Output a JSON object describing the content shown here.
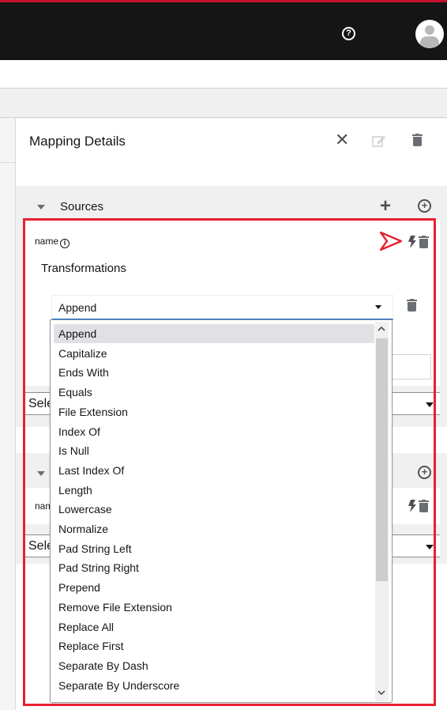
{
  "header": {
    "help_icon": "question-circle-icon",
    "avatar_icon": "user-avatar-icon",
    "brand_color": "#c8102e"
  },
  "panel": {
    "title": "Mapping Details",
    "close_icon": "close-icon",
    "edit_icon": "edit-icon",
    "delete_icon": "trash-icon"
  },
  "sources": {
    "label": "Sources",
    "add_icon": "plus-icon",
    "add_circle_icon": "plus-circle-icon",
    "field": {
      "name": "name",
      "info_icon": "info-icon"
    },
    "transformations_label": "Transformations",
    "transformation_select": {
      "value": "Append"
    },
    "select_row": {
      "value": "Sele"
    }
  },
  "targets": {
    "add_circle_icon": "plus-circle-icon",
    "field": {
      "name": "nam"
    },
    "select_row": {
      "value": "Sele"
    }
  },
  "dropdown": {
    "selected": "Append",
    "options": [
      "Append",
      "Capitalize",
      "Ends With",
      "Equals",
      "File Extension",
      "Index Of",
      "Is Null",
      "Last Index Of",
      "Length",
      "Lowercase",
      "Normalize",
      "Pad String Left",
      "Pad String Right",
      "Prepend",
      "Remove File Extension",
      "Replace All",
      "Replace First",
      "Separate By Dash",
      "Separate By Underscore"
    ],
    "scroll_up_glyph": "^",
    "scroll_down_glyph": "v"
  },
  "annotation": {
    "highlight_color": "#e8202e"
  }
}
